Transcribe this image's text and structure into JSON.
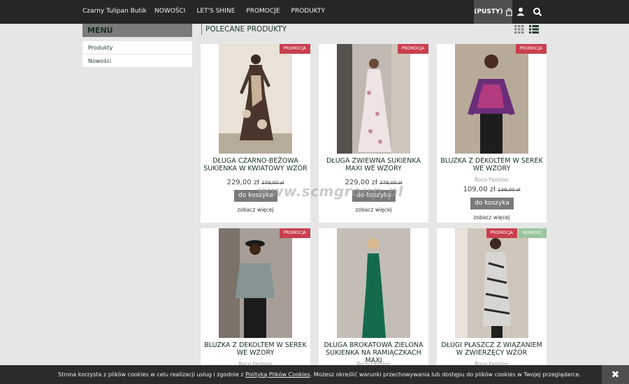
{
  "header": {
    "brand": "Czarny Tulipan Butik",
    "nav": [
      "NOWOŚCI",
      "LET'S SHINE",
      "PROMOCJE",
      "PRODUKTY"
    ],
    "cart_label": "(PUSTY)",
    "icons": [
      "shopping-bag-icon",
      "user-icon",
      "search-icon"
    ]
  },
  "sidebar": {
    "title": "MENU",
    "items": [
      "Produkty",
      "Nowości"
    ]
  },
  "section": {
    "title": "POLECANE PRODUKTY"
  },
  "products": [
    {
      "title": "DŁUGA CZARNO-BEŻOWA SUKIENKA W KWIATOWY WZÓR",
      "price": "229,00 zł",
      "old_price": "279,00 zł",
      "badge": "PROMOCJA",
      "brand": "",
      "button": "do koszyka",
      "more": "zobacz więcej"
    },
    {
      "title": "DŁUGA ZWIEWNA SUKIENKA MAXI WE WZORY",
      "price": "229,00 zł",
      "old_price": "279,00 zł",
      "badge": "PROMOCJA",
      "brand": "",
      "button": "do koszyka",
      "more": "zobacz więcej"
    },
    {
      "title": "BLUZKA Z DEKOLTEM W SEREK WE WZORY",
      "price": "109,00 zł",
      "old_price": "139,00 zł",
      "badge": "PROMOCJA",
      "brand": "Roco Fashion",
      "button": "do koszyka",
      "more": "zobacz więcej"
    },
    {
      "title": "BLUZKA Z DEKOLTEM W SEREK WE WZORY",
      "badge": "PROMOCJA",
      "brand": "Roco Fashion"
    },
    {
      "title": "DŁUGA BROKATOWA ZIELONA SUKIENKA NA RAMIĄCZKACH MAXI",
      "badge": "",
      "brand": "Roco Fashion"
    },
    {
      "title": "DŁUGI PŁASZCZ Z WIĄZANIEM W ZWIERZĘCY WZÓR",
      "badge": "PROMOCJA",
      "badge2": "NOWOŚĆ",
      "brand": "Roco Fashion"
    }
  ],
  "watermark": "www.scmgroup.pl",
  "cookie": {
    "text_before": "Strona korzysta z plików cookies w celu realizacji usług i zgodnie z ",
    "link": "Polityką Plików Cookies",
    "text_after": ". Możesz określić warunki przechowywania lub dostępu do plików cookies w Twojej przeglądarce.",
    "close": "✖"
  },
  "colors": {
    "promo": "#c93f4e",
    "new": "#9ac59f",
    "topbar": "#262626",
    "title_green": "#17321f"
  }
}
